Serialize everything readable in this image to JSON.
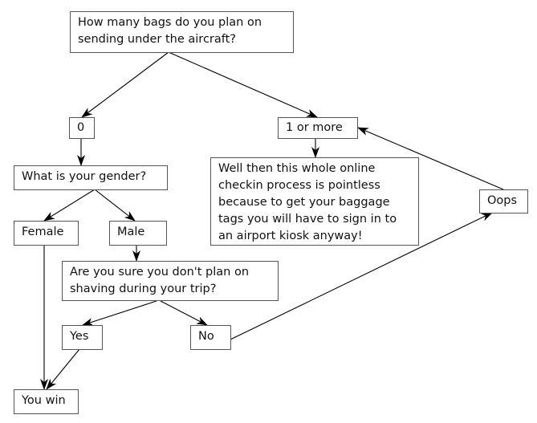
{
  "nodes": {
    "q_bags": "How many bags do you plan on\nsending under the aircraft?",
    "zero": "0",
    "one_or_more": "1 or more",
    "gender": "What is your gender?",
    "pointless": "Well then this whole online\ncheckin process is pointless\nbecause to get your baggage\ntags you will have to sign in to\nan airport kiosk anyway!",
    "oops": "Oops",
    "female": "Female",
    "male": "Male",
    "shaving": "Are you sure you don't plan on\nshaving during your trip?",
    "yes": "Yes",
    "no": "No",
    "you_win": "You win"
  },
  "edges": [
    [
      "q_bags",
      "zero"
    ],
    [
      "q_bags",
      "one_or_more"
    ],
    [
      "zero",
      "gender"
    ],
    [
      "one_or_more",
      "pointless"
    ],
    [
      "gender",
      "female"
    ],
    [
      "gender",
      "male"
    ],
    [
      "male",
      "shaving"
    ],
    [
      "female",
      "you_win"
    ],
    [
      "shaving",
      "yes"
    ],
    [
      "shaving",
      "no"
    ],
    [
      "yes",
      "you_win"
    ],
    [
      "no",
      "oops"
    ],
    [
      "oops",
      "one_or_more"
    ]
  ]
}
